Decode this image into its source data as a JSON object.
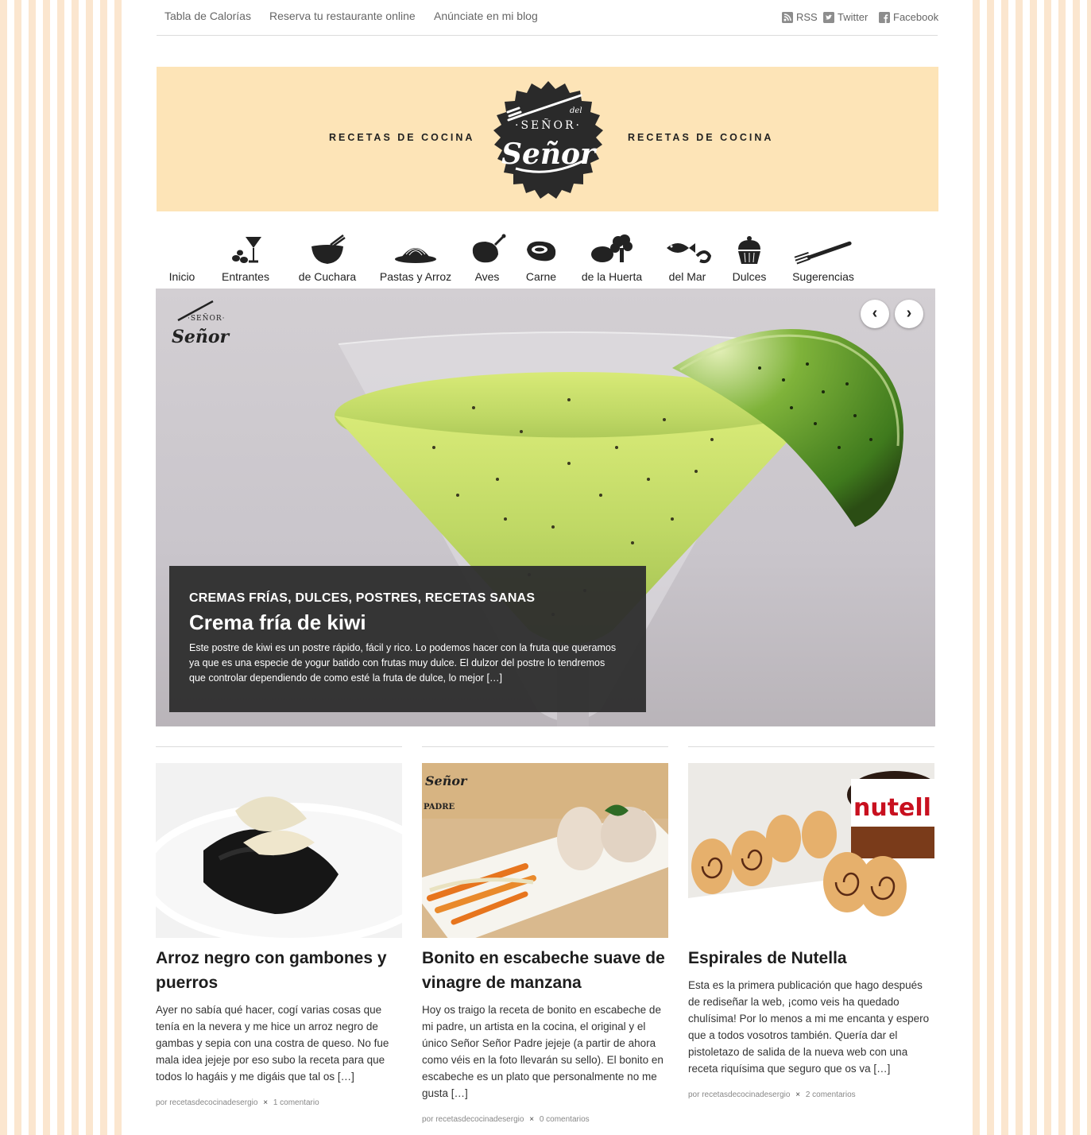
{
  "topnav": {
    "links": [
      "Tabla de Calorías",
      "Reserva tu restaurante online",
      "Anúnciate en mi blog"
    ],
    "social": [
      {
        "icon": "rss-icon",
        "label": "RSS"
      },
      {
        "icon": "twitter-icon",
        "label": "Twitter"
      },
      {
        "icon": "facebook-icon",
        "label": "Facebook"
      }
    ]
  },
  "banner": {
    "left_text": "RECETAS DE COCINA",
    "right_text": "RECETAS DE COCINA",
    "logo_lettering": [
      "del",
      "SEÑOR",
      "Señor"
    ],
    "background": "#fde4b7"
  },
  "nav": {
    "items": [
      {
        "label": "Inicio",
        "icon": ""
      },
      {
        "label": "Entrantes",
        "icon": "cocktail-olives-icon"
      },
      {
        "label": "de Cuchara",
        "icon": "bowl-chopsticks-icon"
      },
      {
        "label": "Pastas y Arroz",
        "icon": "pasta-plate-icon"
      },
      {
        "label": "Aves",
        "icon": "chicken-leg-icon"
      },
      {
        "label": "Carne",
        "icon": "steak-icon"
      },
      {
        "label": "de la Huerta",
        "icon": "vegetables-icon"
      },
      {
        "label": "del Mar",
        "icon": "fish-shrimp-icon"
      },
      {
        "label": "Dulces",
        "icon": "cupcake-icon"
      },
      {
        "label": "Sugerencias",
        "icon": "fork-icon"
      }
    ]
  },
  "slider": {
    "categories": "CREMAS FRÍAS, DULCES, POSTRES, RECETAS SANAS",
    "title": "Crema fría de kiwi",
    "excerpt": "Este postre de kiwi es un postre rápido, fácil y rico. Lo podemos hacer con la fruta que queramos ya que es una especie de yogur batido con frutas muy dulce. El dulzor del postre lo tendremos que controlar dependiendo de como esté la fruta de dulce, lo mejor […]",
    "prev_label": "‹",
    "next_label": "›"
  },
  "posts": [
    {
      "title": "Arroz negro con gambones y puerros",
      "excerpt": "Ayer no sabía qué hacer, cogí varias cosas que tenía en la nevera y me hice un arroz negro de gambas y sepia con una costra de queso. No fue mala idea jejeje por eso subo la receta para que todos lo hagáis y me digáis que tal os […]",
      "author": "por recetasdecocinadesergio",
      "separator": "×",
      "comments": "1 comentario"
    },
    {
      "title": "Bonito en escabeche suave de vinagre de manzana",
      "excerpt": "Hoy os traigo la receta de bonito en escabeche de mi padre, un artista en la cocina, el original y el único Señor Señor Padre jejeje (a partir de ahora como véis en la foto llevarán su sello). El bonito en escabeche es un plato que personalmente no me gusta […]",
      "author": "por recetasdecocinadesergio",
      "separator": "×",
      "comments": "0 comentarios",
      "thumb_stamp": "PADRE"
    },
    {
      "title": "Espirales de Nutella",
      "excerpt": "Esta es la primera publicación que hago después de rediseñar la web, ¡como veis ha quedado chulísima! Por lo menos a mi me encanta y espero que a todos vosotros también. Quería dar el pistoletazo de salida de la nueva web con una receta riquísima que seguro que os va […]",
      "author": "por recetasdecocinadesergio",
      "separator": "×",
      "comments": "2 comentarios",
      "thumb_jar_label": "nutell"
    }
  ]
}
